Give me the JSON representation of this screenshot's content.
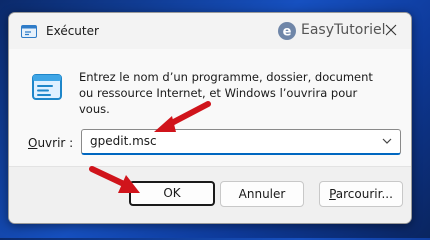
{
  "dialog": {
    "title": "Exécuter",
    "watermark": "EasyTutoriel",
    "description": "Entrez le nom d’un programme, dossier, document ou ressource Internet, et Windows l’ouvrira pour vous.",
    "open_label_first": "O",
    "open_label_rest": "uvrir :",
    "open_value": "gpedit.msc",
    "buttons": {
      "ok": "OK",
      "cancel": "Annuler",
      "browse_first": "P",
      "browse_rest": "arcourir..."
    }
  },
  "colors": {
    "accent": "#0067c0",
    "arrow": "#d0141b",
    "desktop": "#1650c0"
  },
  "icons": [
    "run-app-icon",
    "easytutoriel-logo",
    "close-icon",
    "run-program-icon",
    "chevron-down-icon",
    "red-arrow-icon"
  ]
}
